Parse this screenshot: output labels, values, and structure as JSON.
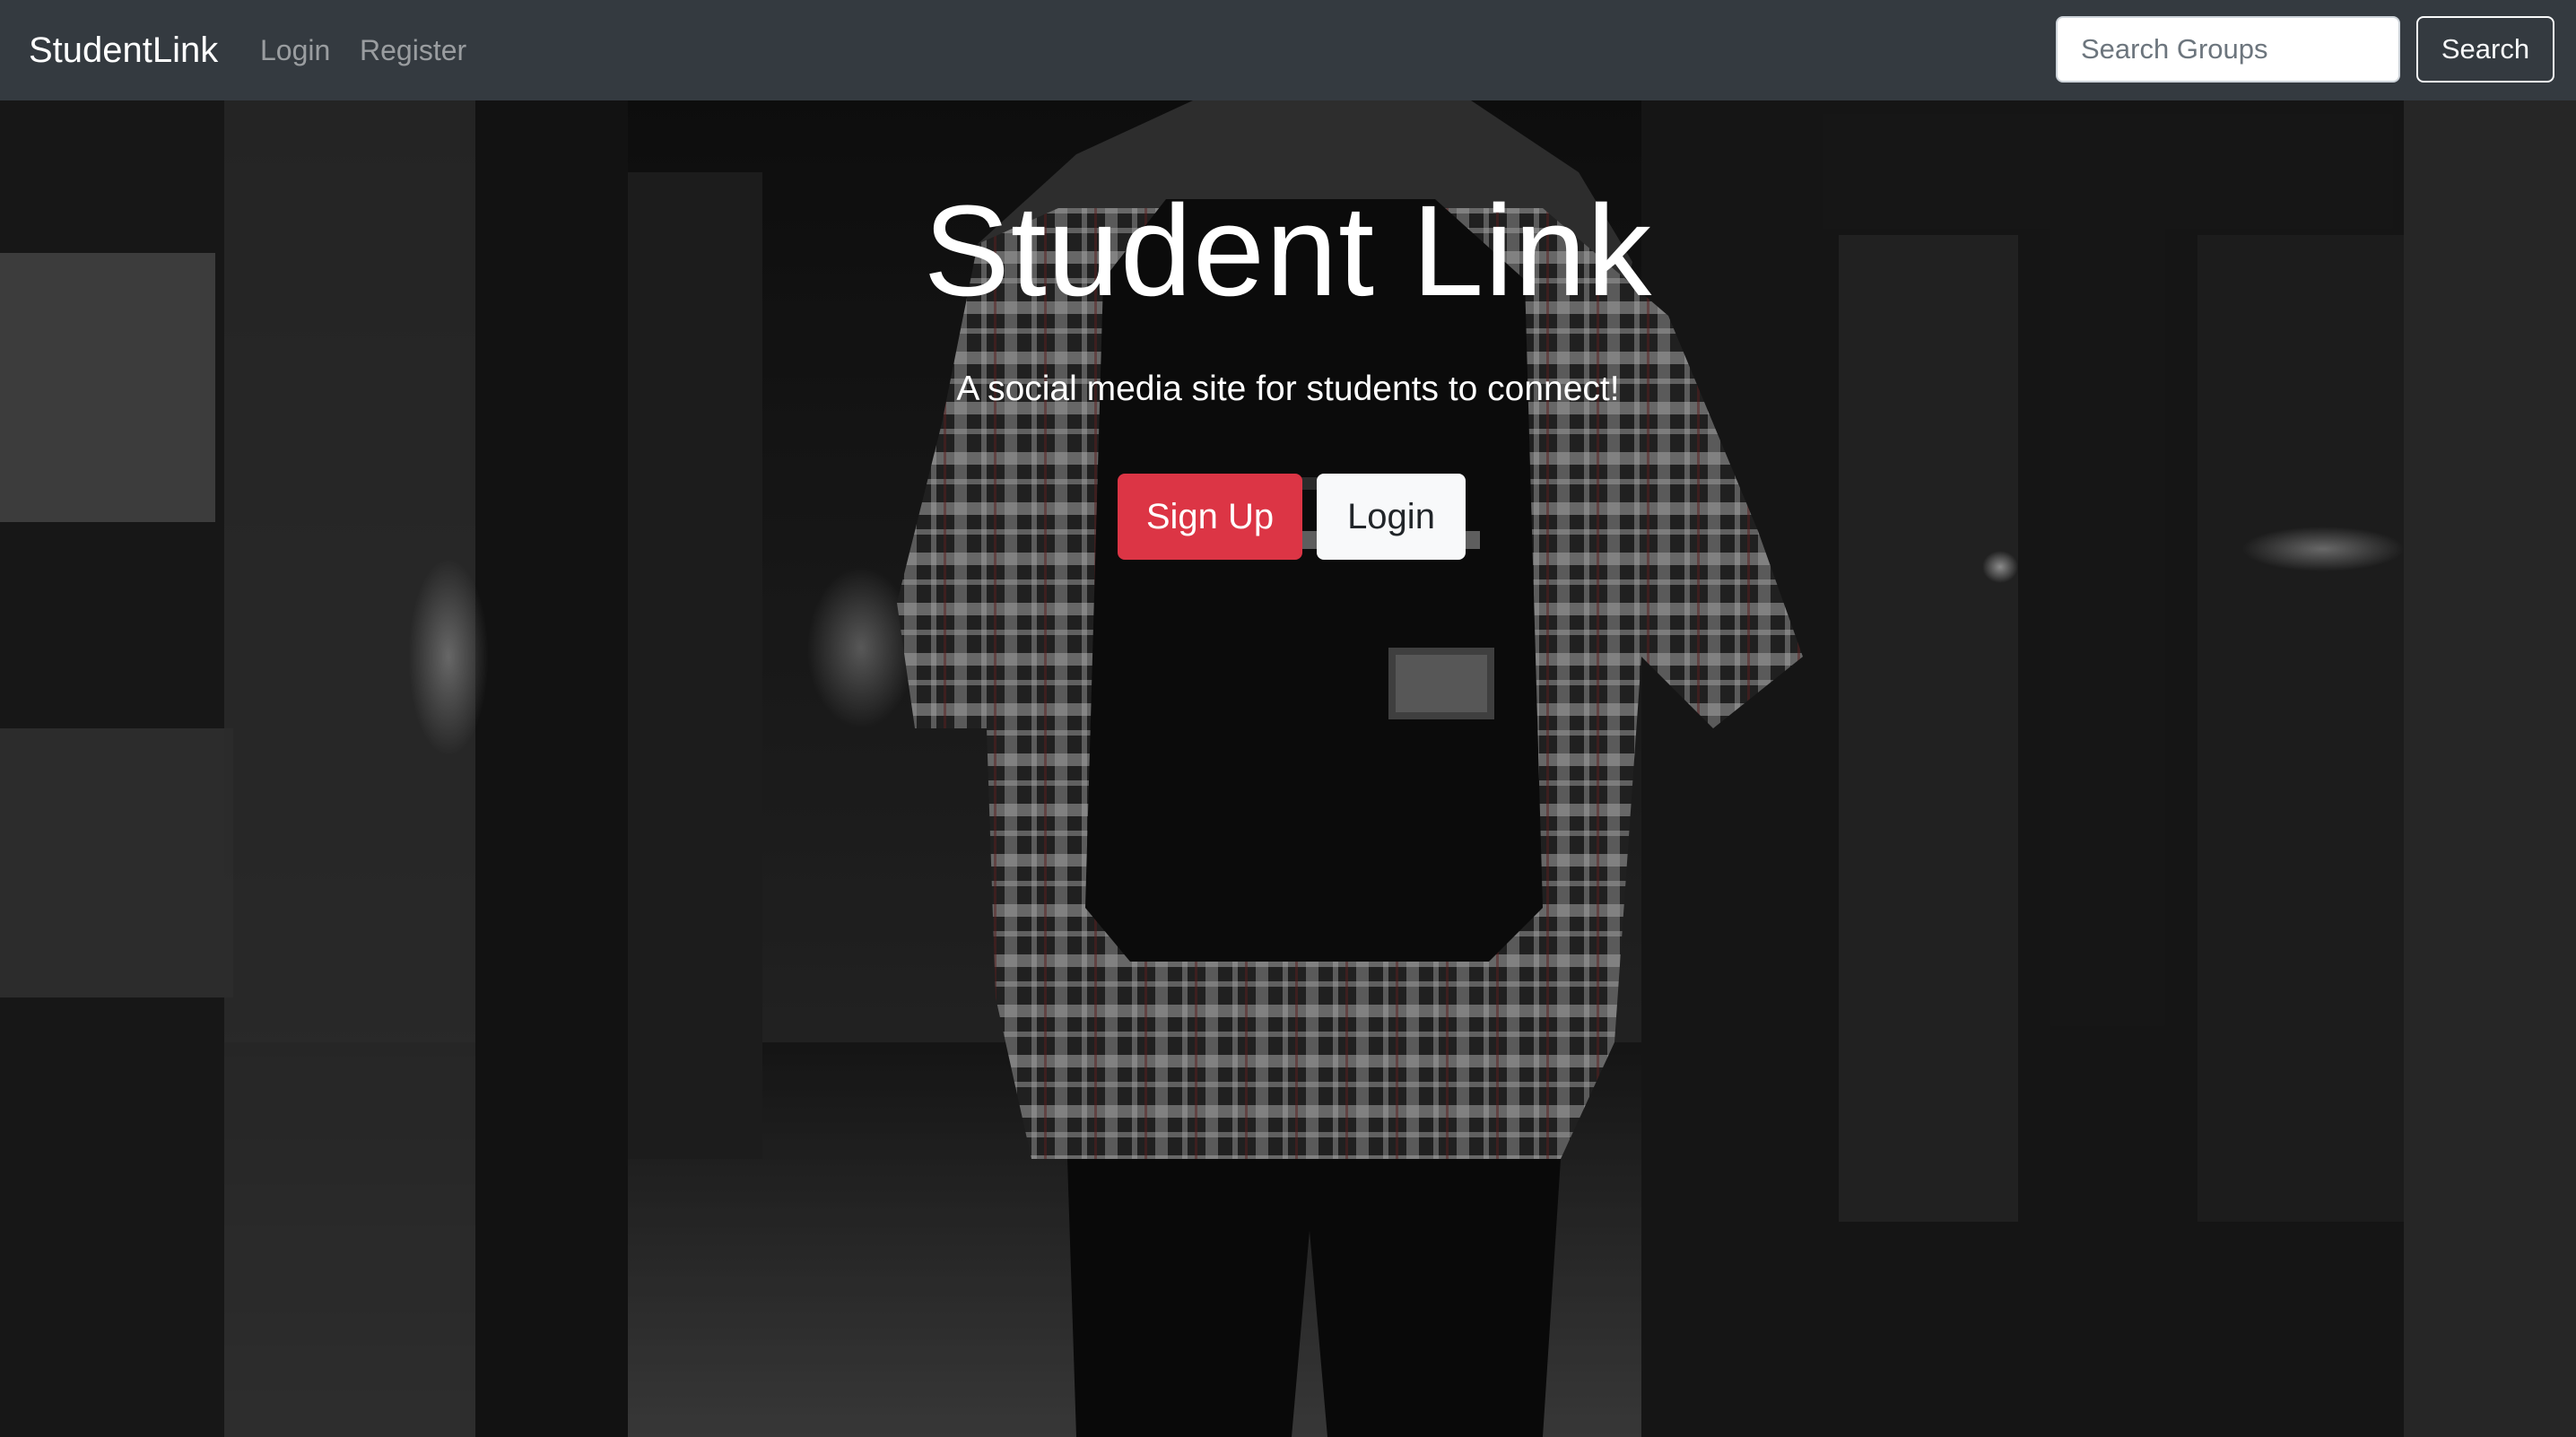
{
  "navbar": {
    "brand": "StudentLink",
    "links": [
      "Login",
      "Register"
    ],
    "search_placeholder": "Search Groups",
    "search_button": "Search"
  },
  "hero": {
    "title": "Student Link",
    "subtitle": "A social media site for students to connect!",
    "signup_button": "Sign Up",
    "login_button": "Login",
    "background_photo": "person-with-backpack-plaid-shirt-in-dark-hallway"
  },
  "colors": {
    "navbar": "#343a40",
    "signup": "#dc3545",
    "login": "#f8f9fa",
    "text_light": "#ffffff"
  }
}
